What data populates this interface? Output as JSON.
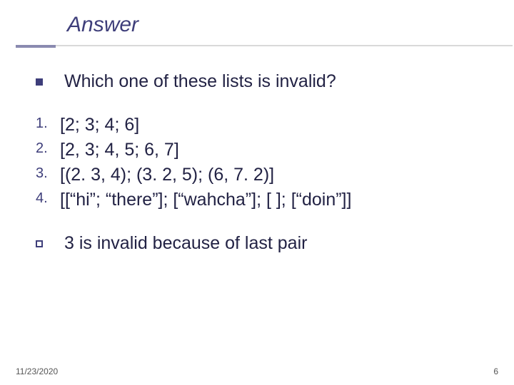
{
  "title": "Answer",
  "question": "Which one of these lists is invalid?",
  "items": [
    {
      "num": "1.",
      "text": "[2; 3; 4; 6]"
    },
    {
      "num": "2.",
      "text": "[2, 3; 4, 5; 6, 7]"
    },
    {
      "num": "3.",
      "text": "[(2. 3, 4); (3. 2, 5); (6, 7. 2)]"
    },
    {
      "num": "4.",
      "text": "[[“hi”; “there”]; [“wahcha”]; [ ]; [“doin”]]"
    }
  ],
  "answer": "3 is invalid because of last pair",
  "footer": {
    "date": "11/23/2020",
    "page": "6"
  }
}
